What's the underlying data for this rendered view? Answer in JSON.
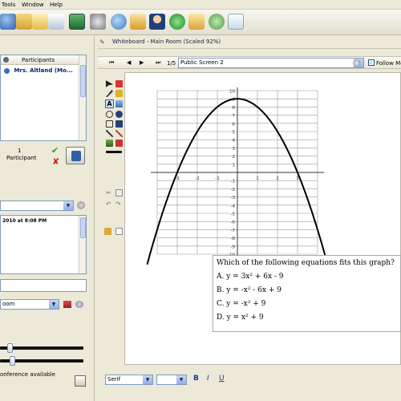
{
  "menu": [
    "Tools",
    "Window",
    "Help"
  ],
  "participants": {
    "header": "Participants",
    "items": [
      "Mrs. Altland (Mo..."
    ],
    "count": "1",
    "count_label": "Participant"
  },
  "chat": {
    "header_text": "2010 at 8:08 PM"
  },
  "room_select": "oom",
  "audio": {
    "status": "onference available"
  },
  "whiteboard": {
    "title": "Whiteboard - Main Room (Scaled 92%)",
    "page": "1/5",
    "screen": "Public Screen 2",
    "follow_label": "Follow Mo"
  },
  "graph": {
    "y_ticks": [
      "10",
      "9",
      "8",
      "7",
      "6",
      "5",
      "4",
      "3",
      "2",
      "1",
      "-1",
      "-2",
      "-3",
      "-4",
      "-5",
      "-6",
      "-7",
      "-8",
      "-9",
      "-10"
    ],
    "x_ticks": [
      "-3",
      "-2",
      "-1",
      "1",
      "2",
      "3"
    ]
  },
  "question": {
    "prompt": "Which of the following equations fits this graph?",
    "options": [
      "A. y = 3x² + 6x - 9",
      "B. y = -x² - 6x + 9",
      "C. y = -x² + 9",
      "D. y = x² + 9"
    ]
  },
  "font": {
    "family": "Serif",
    "bold": "B",
    "italic": "I",
    "underline": "U"
  },
  "colors": {
    "accent": "#0a246a",
    "highlight": "#316ac5"
  }
}
